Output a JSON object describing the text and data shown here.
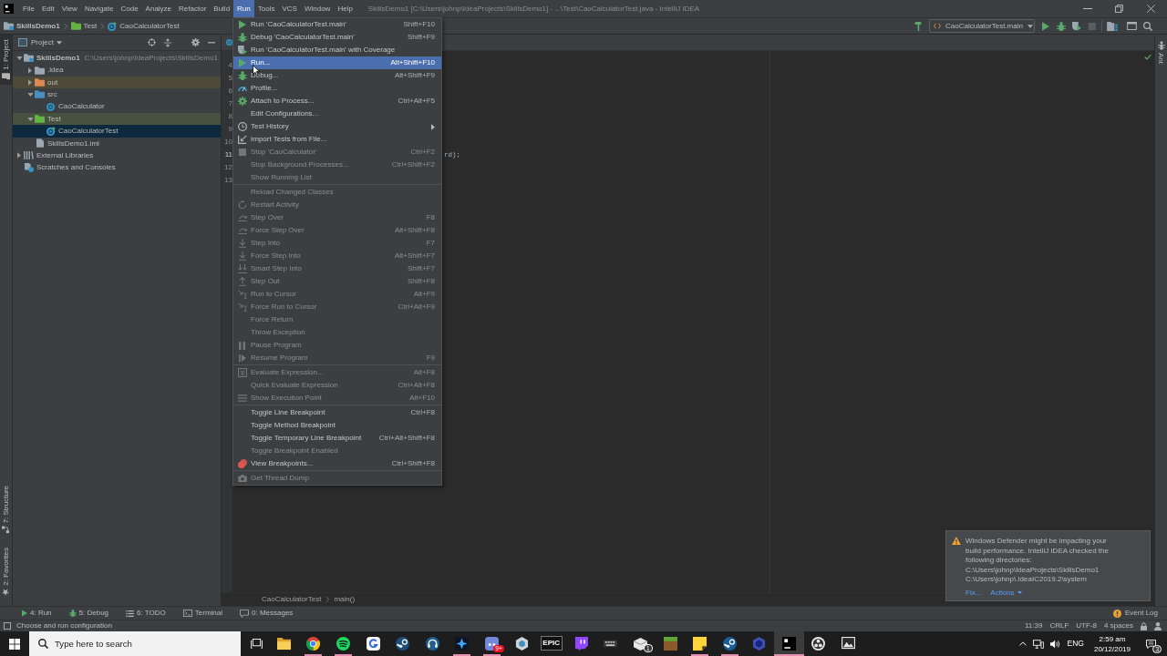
{
  "title_bar": {
    "menu": [
      {
        "label": "File",
        "selected": false
      },
      {
        "label": "Edit",
        "selected": false
      },
      {
        "label": "View",
        "selected": false
      },
      {
        "label": "Navigate",
        "selected": false
      },
      {
        "label": "Code",
        "selected": false
      },
      {
        "label": "Analyze",
        "selected": false
      },
      {
        "label": "Refactor",
        "selected": false
      },
      {
        "label": "Build",
        "selected": false
      },
      {
        "label": "Run",
        "selected": true
      },
      {
        "label": "Tools",
        "selected": false
      },
      {
        "label": "VCS",
        "selected": false
      },
      {
        "label": "Window",
        "selected": false
      },
      {
        "label": "Help",
        "selected": false
      }
    ],
    "title": "SkillsDemo1 [C:\\Users\\johnp\\IdeaProjects\\SkillsDemo1] - ...\\Test\\CaoCalculatorTest.java - IntelliJ IDEA"
  },
  "nav_bar": {
    "breadcrumbs": [
      {
        "label": "SkillsDemo1",
        "kind": "module"
      },
      {
        "label": "Test",
        "kind": "test-folder"
      },
      {
        "label": "CaoCalculatorTest",
        "kind": "test-class"
      }
    ],
    "run_configuration": "CaoCalculatorTest.main",
    "stop_enabled": false
  },
  "left_tool_strip": [
    {
      "label": "1: Project",
      "selected": true
    },
    {
      "label": "7: Structure",
      "selected": false
    },
    {
      "label": "2: Favorites",
      "selected": false
    }
  ],
  "right_tool_strip": [
    {
      "label": "Ant",
      "selected": false
    }
  ],
  "project_panel": {
    "title": "Project",
    "tree": [
      {
        "label": "SkillsDemo1",
        "path": "C:\\Users\\johnp\\IdeaProjects\\SkillsDemo1",
        "kind": "module",
        "expanded": true,
        "selected": false,
        "children": [
          {
            "label": ".idea",
            "kind": "folder",
            "expanded": false,
            "selected": false
          },
          {
            "label": "out",
            "kind": "excluded-folder",
            "expanded": false,
            "selected": false
          },
          {
            "label": "src",
            "kind": "source-folder",
            "expanded": true,
            "selected": false,
            "children": [
              {
                "label": "CaoCalculator",
                "kind": "class",
                "selected": false
              }
            ]
          },
          {
            "label": "Test",
            "kind": "test-folder",
            "expanded": true,
            "selected": false,
            "children": [
              {
                "label": "CaoCalculatorTest",
                "kind": "test-class",
                "selected": true
              }
            ]
          },
          {
            "label": "SkillsDemo1.iml",
            "kind": "file",
            "selected": false
          }
        ]
      },
      {
        "label": "External Libraries",
        "kind": "libraries",
        "expanded": false,
        "selected": false
      },
      {
        "label": "Scratches and Consoles",
        "kind": "scratches",
        "selected": false
      }
    ]
  },
  "editor": {
    "lines": [
      {
        "number": "4",
        "current": false
      },
      {
        "number": "5",
        "current": false
      },
      {
        "number": "6",
        "current": false
      },
      {
        "number": "7",
        "current": false
      },
      {
        "number": "8",
        "current": false
      },
      {
        "number": "9",
        "current": false
      },
      {
        "number": "10",
        "current": false
      },
      {
        "number": "11",
        "current": true,
        "code": "rd);"
      },
      {
        "number": "12",
        "current": false
      },
      {
        "number": "13",
        "current": false
      }
    ],
    "breadcrumbs": [
      "CaoCalculatorTest",
      "main()"
    ]
  },
  "run_menu": {
    "items": [
      {
        "kind": "item",
        "label": "Run 'CaoCalculatorTest.main'",
        "shortcut": "Shift+F10",
        "enabled": true,
        "selected": false
      },
      {
        "kind": "item",
        "label": "Debug 'CaoCalculatorTest.main'",
        "shortcut": "Shift+F9",
        "enabled": true,
        "selected": false
      },
      {
        "kind": "item",
        "label": "Run 'CaoCalculatorTest.main' with Coverage",
        "enabled": true,
        "selected": false
      },
      {
        "kind": "item",
        "label": "Run...",
        "shortcut": "Alt+Shift+F10",
        "enabled": true,
        "selected": true
      },
      {
        "kind": "item",
        "label": "Debug...",
        "shortcut": "Alt+Shift+F9",
        "enabled": true,
        "selected": false
      },
      {
        "kind": "item",
        "label": "Profile...",
        "enabled": true,
        "selected": false
      },
      {
        "kind": "item",
        "label": "Attach to Process...",
        "shortcut": "Ctrl+Alt+F5",
        "enabled": true,
        "selected": false
      },
      {
        "kind": "item",
        "label": "Edit Configurations...",
        "enabled": true,
        "selected": false
      },
      {
        "kind": "submenu",
        "label": "Test History",
        "enabled": true,
        "selected": false
      },
      {
        "kind": "item",
        "label": "Import Tests from File...",
        "enabled": true,
        "selected": false
      },
      {
        "kind": "item",
        "label": "Stop 'CaoCalculator'",
        "shortcut": "Ctrl+F2",
        "enabled": false,
        "selected": false
      },
      {
        "kind": "item",
        "label": "Stop Background Processes...",
        "shortcut": "Ctrl+Shift+F2",
        "enabled": false,
        "selected": false
      },
      {
        "kind": "item",
        "label": "Show Running List",
        "enabled": false,
        "selected": false
      },
      {
        "kind": "separator"
      },
      {
        "kind": "item",
        "label": "Reload Changed Classes",
        "enabled": false,
        "selected": false
      },
      {
        "kind": "item",
        "label": "Restart Activity",
        "enabled": false,
        "selected": false
      },
      {
        "kind": "item",
        "label": "Step Over",
        "shortcut": "F8",
        "enabled": false,
        "selected": false
      },
      {
        "kind": "item",
        "label": "Force Step Over",
        "shortcut": "Alt+Shift+F8",
        "enabled": false,
        "selected": false
      },
      {
        "kind": "item",
        "label": "Step Into",
        "shortcut": "F7",
        "enabled": false,
        "selected": false
      },
      {
        "kind": "item",
        "label": "Force Step Into",
        "shortcut": "Alt+Shift+F7",
        "enabled": false,
        "selected": false
      },
      {
        "kind": "item",
        "label": "Smart Step Into",
        "shortcut": "Shift+F7",
        "enabled": false,
        "selected": false
      },
      {
        "kind": "item",
        "label": "Step Out",
        "shortcut": "Shift+F8",
        "enabled": false,
        "selected": false
      },
      {
        "kind": "item",
        "label": "Run to Cursor",
        "shortcut": "Alt+F9",
        "enabled": false,
        "selected": false
      },
      {
        "kind": "item",
        "label": "Force Run to Cursor",
        "shortcut": "Ctrl+Alt+F9",
        "enabled": false,
        "selected": false
      },
      {
        "kind": "item",
        "label": "Force Return",
        "enabled": false,
        "selected": false
      },
      {
        "kind": "item",
        "label": "Throw Exception",
        "enabled": false,
        "selected": false
      },
      {
        "kind": "item",
        "label": "Pause Program",
        "enabled": false,
        "selected": false
      },
      {
        "kind": "item",
        "label": "Resume Program",
        "shortcut": "F9",
        "enabled": false,
        "selected": false
      },
      {
        "kind": "separator"
      },
      {
        "kind": "item",
        "label": "Evaluate Expression...",
        "shortcut": "Alt+F8",
        "enabled": false,
        "selected": false
      },
      {
        "kind": "item",
        "label": "Quick Evaluate Expression",
        "shortcut": "Ctrl+Alt+F8",
        "enabled": false,
        "selected": false
      },
      {
        "kind": "item",
        "label": "Show Execution Point",
        "shortcut": "Alt+F10",
        "enabled": false,
        "selected": false
      },
      {
        "kind": "separator"
      },
      {
        "kind": "item",
        "label": "Toggle Line Breakpoint",
        "shortcut": "Ctrl+F8",
        "enabled": true,
        "selected": false
      },
      {
        "kind": "item",
        "label": "Toggle Method Breakpoint",
        "enabled": true,
        "selected": false
      },
      {
        "kind": "item",
        "label": "Toggle Temporary Line Breakpoint",
        "shortcut": "Ctrl+Alt+Shift+F8",
        "enabled": true,
        "selected": false
      },
      {
        "kind": "item",
        "label": "Toggle Breakpoint Enabled",
        "enabled": false,
        "selected": false
      },
      {
        "kind": "item",
        "label": "View Breakpoints...",
        "shortcut": "Ctrl+Shift+F8",
        "enabled": true,
        "selected": false
      },
      {
        "kind": "separator"
      },
      {
        "kind": "item",
        "label": "Get Thread Dump",
        "enabled": false,
        "selected": false
      }
    ]
  },
  "notification": {
    "message": "Windows Defender might be impacting your build performance. IntelliJ IDEA checked the following directories:",
    "paths": [
      "C:\\Users\\johnp\\IdeaProjects\\SkillsDemo1",
      "C:\\Users\\johnp\\.IdeaIC2019.2\\system"
    ],
    "links": [
      {
        "label": "Fix...",
        "kind": "link"
      },
      {
        "label": "Actions",
        "kind": "dropdown"
      }
    ]
  },
  "tool_window_bar": {
    "tabs": [
      {
        "label": "4: Run",
        "selected": false
      },
      {
        "label": "5: Debug",
        "selected": false
      },
      {
        "label": "6: TODO",
        "selected": false
      },
      {
        "label": "Terminal",
        "selected": false
      },
      {
        "label": "0: Messages",
        "selected": false
      }
    ],
    "event_log": "Event Log"
  },
  "status_bar": {
    "message": "Choose and run configuration",
    "items": [
      "11:39",
      "CRLF",
      "UTF-8",
      "4 spaces"
    ]
  },
  "taskbar": {
    "search": {
      "placeholder": "Type here to search"
    },
    "apps": [
      {
        "running": false,
        "active": false
      },
      {
        "running": true,
        "active": false
      },
      {
        "running": true,
        "active": false
      },
      {
        "running": false,
        "active": false
      },
      {
        "running": false,
        "active": false
      },
      {
        "running": false,
        "active": false
      },
      {
        "running": true,
        "active": false
      },
      {
        "running": true,
        "active": false,
        "badge": "9+"
      },
      {
        "running": false,
        "active": false
      },
      {
        "running": false,
        "active": false,
        "logo_text": "EPIC"
      },
      {
        "running": false,
        "active": false
      },
      {
        "running": false,
        "active": false
      },
      {
        "running": false,
        "active": false,
        "badge": "1"
      },
      {
        "running": false,
        "active": false
      },
      {
        "running": true,
        "active": false
      },
      {
        "running": true,
        "active": false
      },
      {
        "running": false,
        "active": false
      },
      {
        "running": true,
        "active": true
      },
      {
        "running": false,
        "active": false
      },
      {
        "running": false,
        "active": false
      }
    ],
    "tray": {
      "language": "ENG",
      "time": "2:59 am",
      "date": "20/12/2019",
      "notification_count": "3"
    }
  }
}
